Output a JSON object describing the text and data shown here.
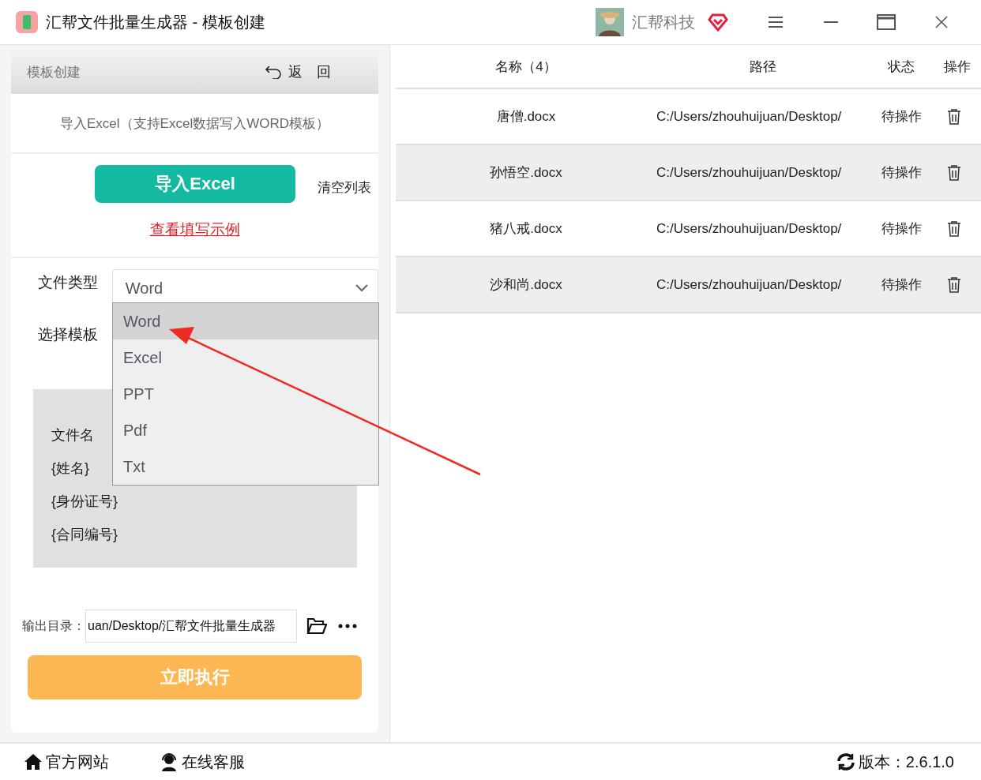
{
  "window": {
    "title": "汇帮文件批量生成器 - 模板创建",
    "brand": "汇帮科技"
  },
  "panel": {
    "title": "模板创建",
    "back": "返　回",
    "import_hint": "导入Excel（支持Excel数据写入WORD模板）",
    "import_button": "导入Excel",
    "clear_button": "清空列表",
    "example_link": "查看填写示例",
    "file_type": {
      "label": "文件类型",
      "value": "Word",
      "expanded": true,
      "options": [
        {
          "label": "Word",
          "selected": true
        },
        {
          "label": "Excel",
          "selected": false
        },
        {
          "label": "PPT",
          "selected": false
        },
        {
          "label": "Pdf",
          "selected": false
        },
        {
          "label": "Txt",
          "selected": false
        }
      ]
    },
    "template": {
      "label": "选择模板",
      "fields": [
        "文件名",
        "{姓名}",
        "{身份证号}",
        "{合同编号}"
      ]
    },
    "output": {
      "label": "输出目录：",
      "value": "uan/Desktop/汇帮文件批量生成器"
    },
    "run_button": "立即执行"
  },
  "table": {
    "columns": [
      "名称（4）",
      "路径",
      "状态",
      "操作"
    ],
    "rows": [
      {
        "name": "唐僧.docx",
        "path": "C:/Users/zhouhuijuan/Desktop/",
        "status": "待操作"
      },
      {
        "name": "孙悟空.docx",
        "path": "C:/Users/zhouhuijuan/Desktop/",
        "status": "待操作"
      },
      {
        "name": "猪八戒.docx",
        "path": "C:/Users/zhouhuijuan/Desktop/",
        "status": "待操作"
      },
      {
        "name": "沙和尚.docx",
        "path": "C:/Users/zhouhuijuan/Desktop/",
        "status": "待操作"
      }
    ]
  },
  "footer": {
    "links": [
      "官方网站",
      "在线客服"
    ],
    "version": "版本：2.6.1.0"
  }
}
